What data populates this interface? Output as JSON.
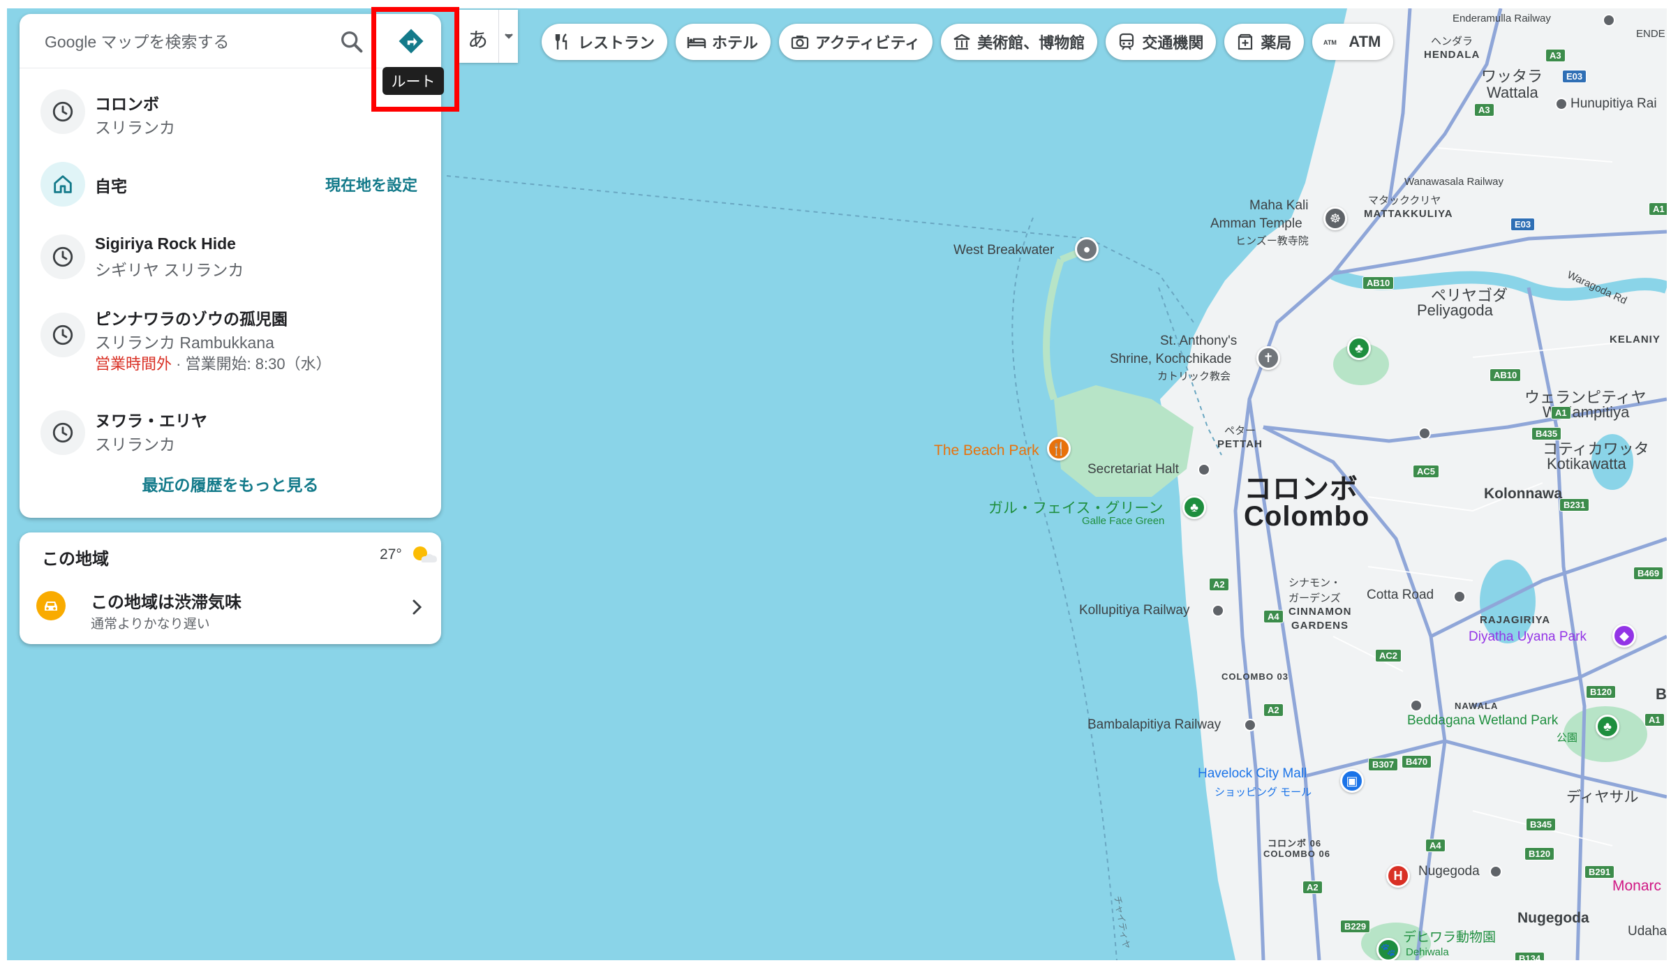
{
  "search": {
    "placeholder": "Google マップを検索する"
  },
  "route": {
    "tooltip": "ルート",
    "icon": "directions-icon"
  },
  "ime": {
    "char": "あ"
  },
  "chips": [
    {
      "label": "レストラン",
      "icon": "restaurant-icon"
    },
    {
      "label": "ホテル",
      "icon": "hotel-icon"
    },
    {
      "label": "アクティビティ",
      "icon": "camera-icon"
    },
    {
      "label": "美術館、博物館",
      "icon": "museum-icon"
    },
    {
      "label": "交通機関",
      "icon": "transit-icon"
    },
    {
      "label": "薬局",
      "icon": "pharmacy-icon"
    },
    {
      "label": "ATM",
      "icon": "atm-icon"
    }
  ],
  "history": [
    {
      "title": "コロンボ",
      "subtitle": "スリランカ",
      "icon": "clock-icon"
    },
    {
      "title": "自宅",
      "action": "現在地を設定",
      "icon": "home-icon"
    },
    {
      "title": "Sigiriya Rock Hide",
      "subtitle": "シギリヤ スリランカ",
      "icon": "clock-icon"
    },
    {
      "title": "ピンナワラのゾウの孤児園",
      "subtitle": "スリランカ Rambukkana",
      "status_closed": "営業時間外",
      "status_open": " · 営業開始: 8:30（水）",
      "icon": "clock-icon"
    },
    {
      "title": "ヌワラ・エリヤ",
      "subtitle": "スリランカ",
      "icon": "clock-icon"
    }
  ],
  "more_history": "最近の履歴をもっと見る",
  "area": {
    "title": "この地域",
    "temp": "27°",
    "traffic_title": "この地域は渋滞気味",
    "traffic_sub": "通常よりかなり遅い",
    "accent": "#f9ab00"
  },
  "map_labels": {
    "enderamulla": "Enderamulla Railway",
    "hendala_jp": "ヘンダラ",
    "hendala": "HENDALA",
    "wattala_jp": "ワッタラ",
    "wattala": "Wattala",
    "hunupitiya": "Hunupitiya Rai",
    "wanawasala": "Wanawasala Railway",
    "mattakkuliya_jp": "マタッククリヤ",
    "mattakkuliya": "MATTAKKULIYA",
    "maha_kali": "Maha Kali",
    "amman_temple": "Amman Temple",
    "hindu_temple_jp": "ヒンズー教寺院",
    "west_breakwater": "West Breakwater",
    "peliyagoda_jp": "ペリヤゴダ",
    "peliyagoda": "Peliyagoda",
    "waragoda_rd": "Waragoda Rd",
    "kelaniya": "KELANIY",
    "st_anthony1": "St. Anthony's",
    "st_anthony2": "Shrine, Kochchikade",
    "catholic_jp": "カトリック教会",
    "wellampitiya_jp": "ウェランピティヤ",
    "wellampitiya": "Wellampitiya",
    "pettah_jp": "ペター",
    "pettah": "PETTAH",
    "kotikawatta_jp": "コティカワッタ",
    "kotikawatta": "Kotikawatta",
    "beach_park": "The Beach Park",
    "secretariat": "Secretariat Halt",
    "colombo_jp": "コロンボ",
    "colombo": "Colombo",
    "kolonnawa": "Kolonnawa",
    "galle_face_jp": "ガル・フェイス・グリーン",
    "galle_face": "Galle Face Green",
    "cinnamon_jp1": "シナモン・",
    "cinnamon_jp2": "ガーデンズ",
    "cinnamon1": "CINNAMON",
    "cinnamon2": "GARDENS",
    "cotta_road": "Cotta Road",
    "kollupitiya": "Kollupitiya Railway",
    "rajagiriya": "RAJAGIRIYA",
    "diyatha": "Diyatha Uyana Park",
    "colombo03": "COLOMBO 03",
    "nawala": "NAWALA",
    "bambalapitiya": "Bambalapitiya Railway",
    "beddagana": "Beddagana Wetland Park",
    "park_jp": "公園",
    "havelock": "Havelock City Mall",
    "mall_jp": "ショッピング モール",
    "diyatha_jp": "ディヤサル",
    "colombo06_jp": "コロンボ 06",
    "colombo06": "COLOMBO 06",
    "nugegoda_rail": "Nugegoda",
    "monara": "Monarc",
    "nugegoda": "Nugegoda",
    "dehiwala_jp": "デヒワラ動物園",
    "dehiwala": "Dehiwala",
    "udaha": "Udaha",
    "chaitiya": "チャイティヤ",
    "ende": "ENDE",
    "b": "B"
  },
  "road_shields": [
    "A3",
    "E03",
    "A3",
    "A1",
    "E03",
    "AB10",
    "AB10",
    "A1",
    "B435",
    "AC5",
    "B231",
    "B469",
    "A2",
    "A4",
    "AC2",
    "B120",
    "A2",
    "B307",
    "B470",
    "A1",
    "B345",
    "A4",
    "B120",
    "B291",
    "A2",
    "B229",
    "B134"
  ],
  "colors": {
    "sea": "#8ad4e8",
    "land": "#f1f3f4",
    "park": "#b7e4c7",
    "road": "#8fa6d8",
    "highlight": "#ff0000",
    "accent_teal": "#137a8a"
  }
}
